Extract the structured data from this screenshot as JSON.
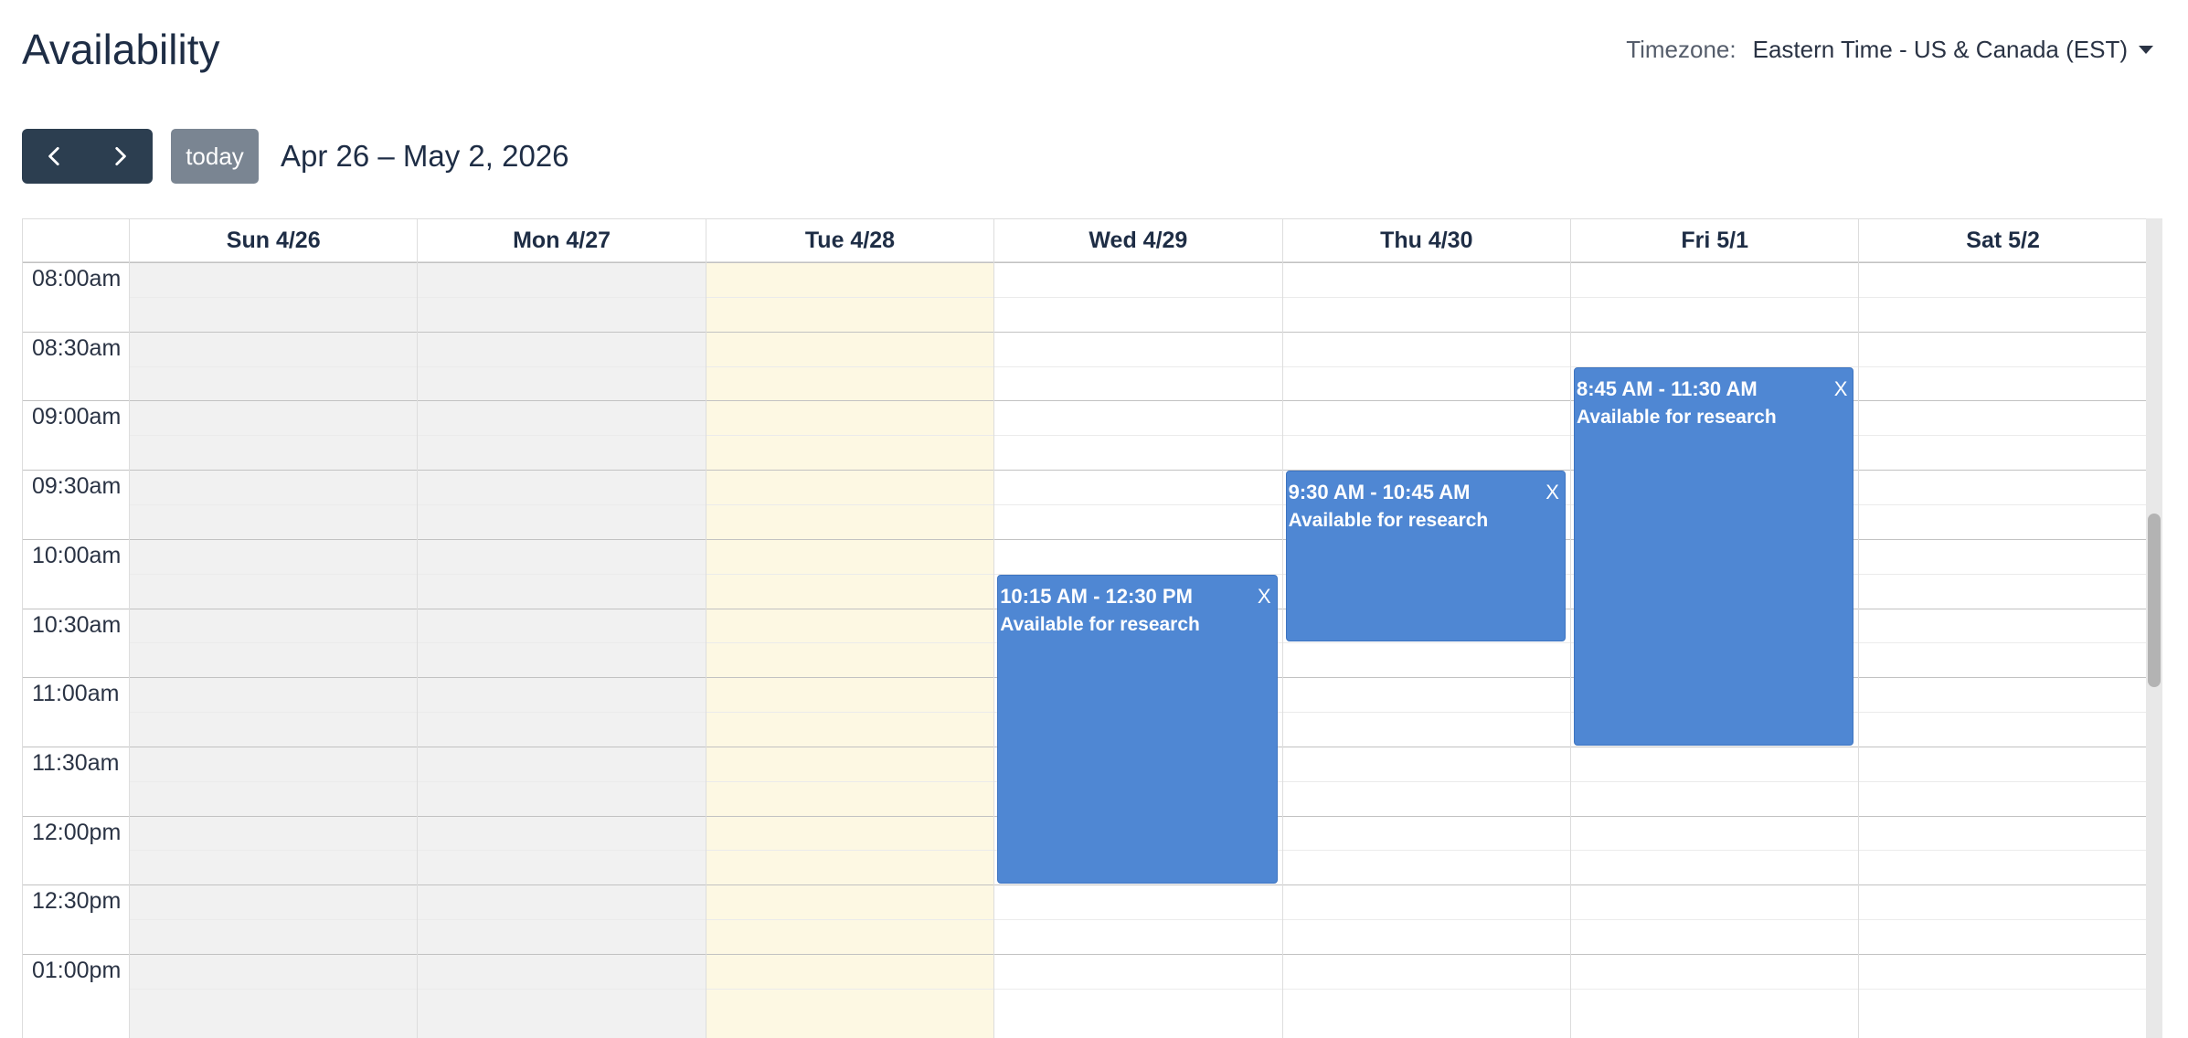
{
  "page": {
    "title": "Availability"
  },
  "timezone": {
    "label": "Timezone:",
    "value": "Eastern Time - US & Canada (EST)"
  },
  "toolbar": {
    "prev_icon": "chevron-left-icon",
    "next_icon": "chevron-right-icon",
    "today_label": "today",
    "range_title": "Apr 26 – May 2, 2026"
  },
  "calendar": {
    "days": [
      {
        "label": "Sun 4/26",
        "state": "past"
      },
      {
        "label": "Mon 4/27",
        "state": "past"
      },
      {
        "label": "Tue 4/28",
        "state": "today"
      },
      {
        "label": "Wed 4/29",
        "state": "future"
      },
      {
        "label": "Thu 4/30",
        "state": "future"
      },
      {
        "label": "Fri 5/1",
        "state": "future"
      },
      {
        "label": "Sat 5/2",
        "state": "future"
      }
    ],
    "time_slots": [
      "08:00am",
      "08:30am",
      "09:00am",
      "09:30am",
      "10:00am",
      "10:30am",
      "11:00am",
      "11:30am",
      "12:00pm",
      "12:30pm",
      "01:00pm"
    ],
    "colors": {
      "past": "#f1f1f1",
      "today": "#fdf8e3",
      "event": "#4f87d3"
    },
    "events": [
      {
        "day": 3,
        "start": "10:15",
        "end": "12:30",
        "time_label": "10:15 AM - 12:30 PM",
        "title": "Available for research",
        "close_label": "X"
      },
      {
        "day": 4,
        "start": "09:30",
        "end": "10:45",
        "time_label": "9:30 AM - 10:45 AM",
        "title": "Available for research",
        "close_label": "X"
      },
      {
        "day": 5,
        "start": "08:45",
        "end": "11:30",
        "time_label": "8:45 AM - 11:30 AM",
        "title": "Available for research",
        "close_label": "X"
      }
    ]
  }
}
